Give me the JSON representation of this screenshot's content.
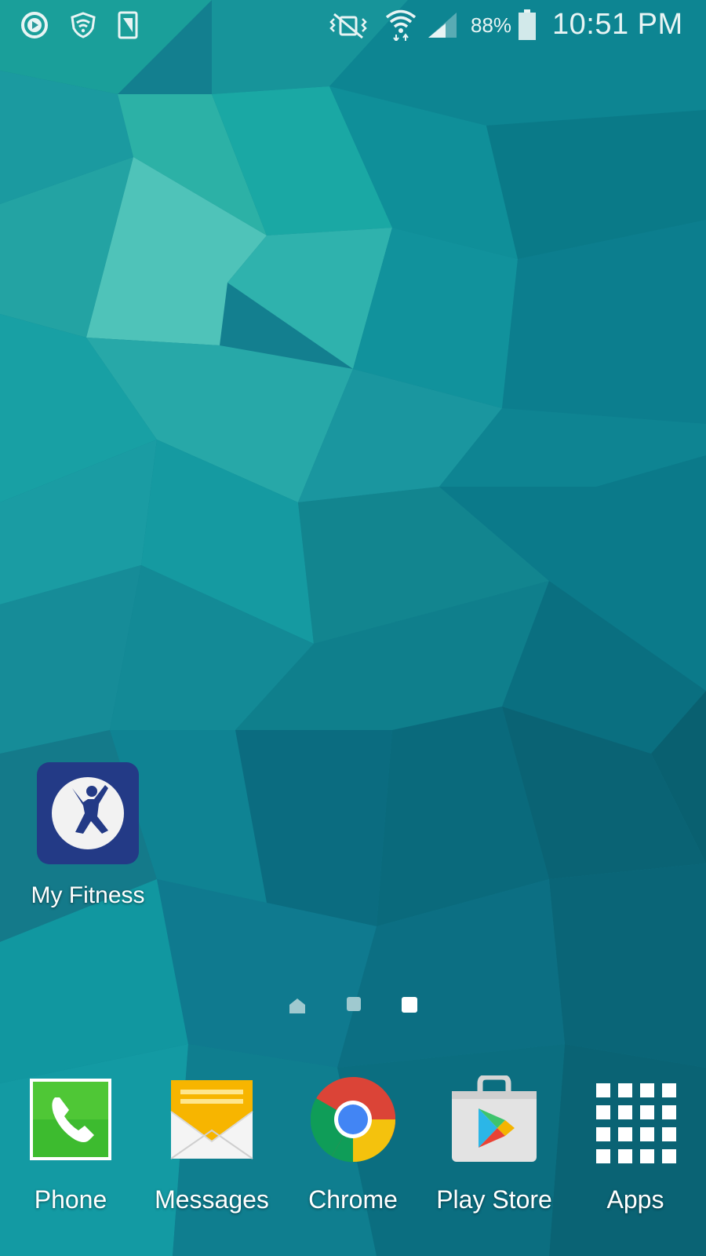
{
  "status_bar": {
    "left_icons": [
      "play-notification-icon",
      "shield-wifi-icon",
      "screenshot-phone-icon"
    ],
    "right_icons": [
      "vibrate-mute-icon",
      "wifi-icon",
      "cell-signal-icon",
      "battery-icon"
    ],
    "battery_percent": "88%",
    "battery_level": 0.88,
    "time": "10:51 PM"
  },
  "home": {
    "apps": [
      {
        "label": "My Fitness",
        "icon": "my-fitness-icon",
        "colors": {
          "bg": "#233a86",
          "circle": "#f2f2f2",
          "figure": "#233a86"
        }
      }
    ]
  },
  "page_indicator": {
    "pages": 3,
    "current": 2,
    "home_page": 0,
    "active_color": "#ffffff",
    "inactive_color": "#9fc9cf"
  },
  "dock": {
    "items": [
      {
        "label": "Phone",
        "icon": "phone-icon",
        "color": "#3dbb2f"
      },
      {
        "label": "Messages",
        "icon": "messages-envelope-icon",
        "color": "#f7b500"
      },
      {
        "label": "Chrome",
        "icon": "chrome-icon",
        "color": "#4285f4"
      },
      {
        "label": "Play Store",
        "icon": "play-store-bag-icon",
        "color": "#e0e0e0"
      },
      {
        "label": "Apps",
        "icon": "apps-grid-icon",
        "color": "#ffffff"
      }
    ]
  },
  "wallpaper": {
    "base_color": "#127f8e",
    "accent_light": "#4fc4b8",
    "accent_dark": "#0a5f70"
  }
}
